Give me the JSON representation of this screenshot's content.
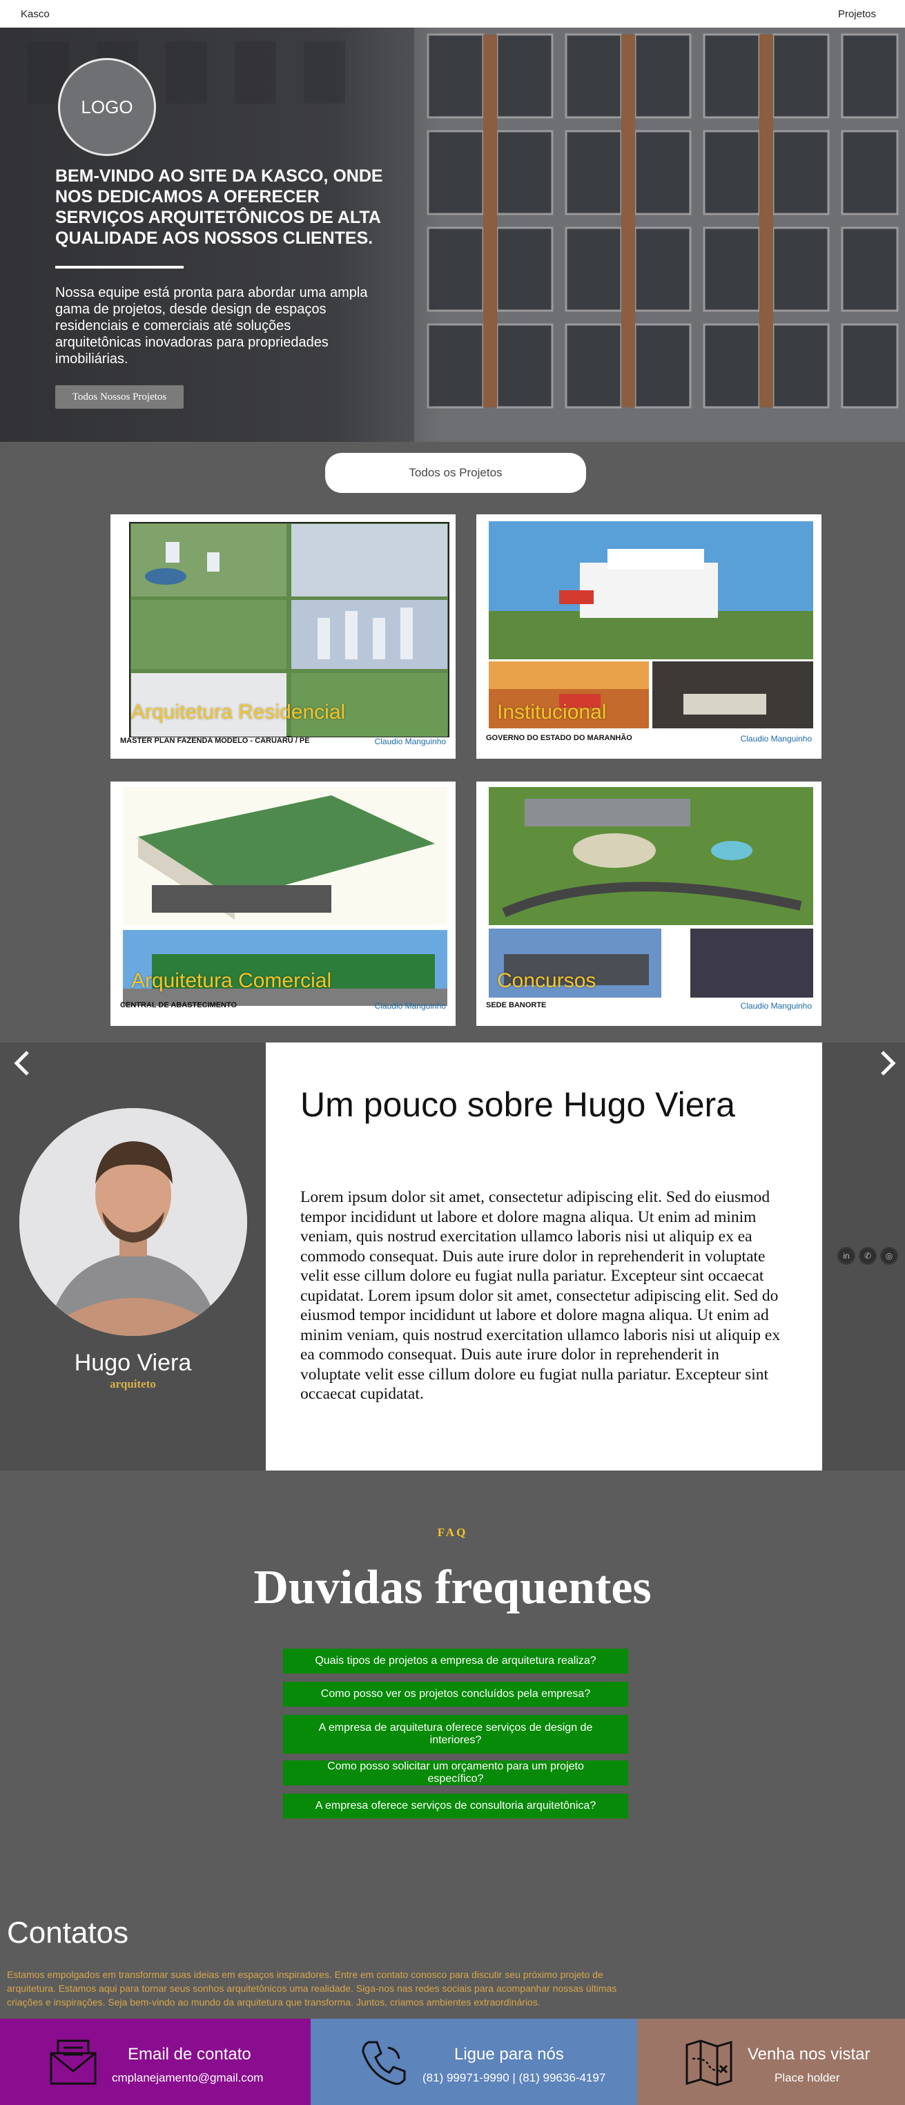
{
  "nav": {
    "brand": "Kasco",
    "projects_link": "Projetos"
  },
  "hero": {
    "logo": "LOGO",
    "title": "BEM-VINDO AO SITE DA KASCO, ONDE NOS DEDICAMOS A OFERECER SERVIÇOS ARQUITETÔNICOS DE ALTA QUALIDADE AOS NOSSOS CLIENTES.",
    "text": "Nossa equipe está pronta para abordar uma ampla gama de projetos, desde design de espaços residenciais e comerciais até soluções arquitetônicas inovadoras para propriedades imobiliárias.",
    "button": "Todos Nossos Projetos"
  },
  "projects": {
    "button": "Todos os Projetos",
    "cards": [
      {
        "label": "Arquitetura Residencial",
        "caption": "MASTER PLAN FAZENDA MODELO - CARUARU / PE",
        "brand": "Claudio Manguinho"
      },
      {
        "label": "Institucional",
        "caption": "GOVERNO DO ESTADO DO MARANHÃO",
        "brand": "Claudio Manguinho"
      },
      {
        "label": "Arquitetura Comercial",
        "caption": "CENTRAL DE ABASTECIMENTO",
        "brand": "Claudio Manguinho"
      },
      {
        "label": "Concursos",
        "caption": "SEDE BANORTE",
        "brand": "Claudio Manguinho"
      }
    ]
  },
  "about": {
    "name": "Hugo Viera",
    "role": "arquiteto",
    "title": "Um pouco sobre Hugo Viera",
    "body": "Lorem ipsum dolor sit amet, consectetur adipiscing elit. Sed do eiusmod tempor incididunt ut labore et dolore magna aliqua. Ut enim ad minim veniam, quis nostrud exercitation ullamco laboris nisi ut aliquip ex ea commodo consequat. Duis aute irure dolor in reprehenderit in voluptate velit esse cillum dolore eu fugiat nulla pariatur. Excepteur sint occaecat cupidatat. Lorem ipsum dolor sit amet, consectetur adipiscing elit. Sed do eiusmod tempor incididunt ut labore et dolore magna aliqua. Ut enim ad minim veniam, quis nostrud exercitation ullamco laboris nisi ut aliquip ex ea commodo consequat. Duis aute irure dolor in reprehenderit in voluptate velit esse cillum dolore eu fugiat nulla pariatur. Excepteur sint occaecat cupidatat.",
    "prev_icon": "chevron-left-icon",
    "next_icon": "chevron-right-icon",
    "social": [
      "linkedin-icon",
      "whatsapp-icon",
      "instagram-icon"
    ]
  },
  "faq": {
    "kicker": "FAQ",
    "title": "Duvidas frequentes",
    "questions": [
      "Quais tipos de projetos a empresa de arquitetura realiza?",
      "Como posso ver os projetos concluídos pela empresa?",
      "A empresa de arquitetura oferece serviços de design de interiores?",
      "Como posso solicitar um orçamento para um projeto específico?",
      "A empresa oferece serviços de consultoria arquitetônica?"
    ]
  },
  "contacts": {
    "title": "Contatos",
    "text": "Estamos empolgados em transformar suas ideias em espaços inspiradores. Entre em contato conosco para discutir seu próximo projeto de arquitetura. Estamos aqui para tornar seus sonhos arquitetônicos uma realidade. Siga-nos nas redes sociais para acompanhar nossas últimas criações e inspirações. Seja bem-vindo ao mundo da arquitetura que transforma. Juntos, criamos ambientes extraordinários.",
    "email": {
      "title": "Email de contato",
      "value": "cmplanejamento@gmail.com",
      "color": "#8a0d8f",
      "icon": "envelope-icon"
    },
    "phone": {
      "title": "Ligue para nós",
      "value": "(81) 99971-9990 | (81) 99636-4197",
      "color": "#5d84bb",
      "icon": "phone-icon"
    },
    "visit": {
      "title": "Venha nos vistar",
      "value": "Place holder",
      "color": "#9d7566",
      "icon": "map-icon"
    }
  }
}
